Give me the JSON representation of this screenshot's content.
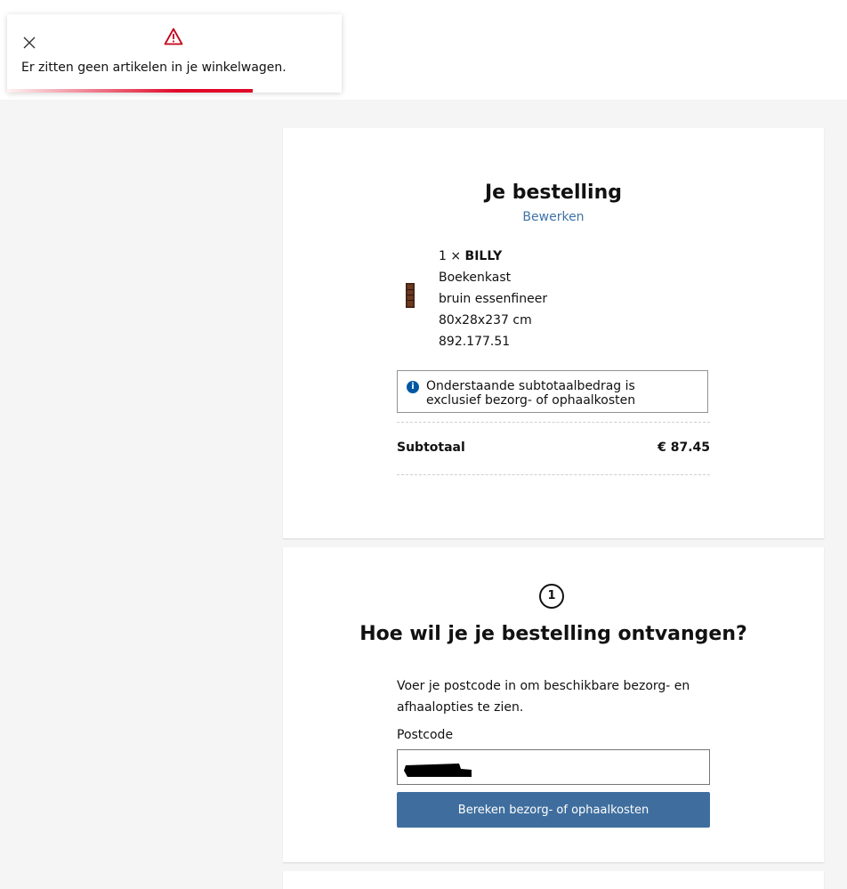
{
  "toast": {
    "close_icon": "close-icon",
    "warning_icon": "warning-triangle-icon",
    "message": "Er zitten geen artikelen in je winkelwagen.",
    "accent_color": "#e00728"
  },
  "order": {
    "title": "Je bestelling",
    "edit_label": "Bewerken",
    "item": {
      "quantity_prefix": "1 × ",
      "name": "BILLY",
      "type": "Boekenkast",
      "color": "bruin essenfineer",
      "dimensions": "80x28x237 cm",
      "article_number": "892.177.51"
    },
    "info": "Onderstaande subtotaalbedrag is exclusief bezorg- of ophaalkosten",
    "subtotal_label": "Subtotaal",
    "subtotal_value": "€ 87.45"
  },
  "delivery": {
    "step_number": "1",
    "title": "Hoe wil je je bestelling ontvangen?",
    "description": "Voer je postcode in om beschikbare bezorg- en afhaalopties te zien.",
    "postcode_label": "Postcode",
    "calculate_button": "Bereken bezorg- of ophaalkosten",
    "button_color": "#3f6e9e"
  }
}
